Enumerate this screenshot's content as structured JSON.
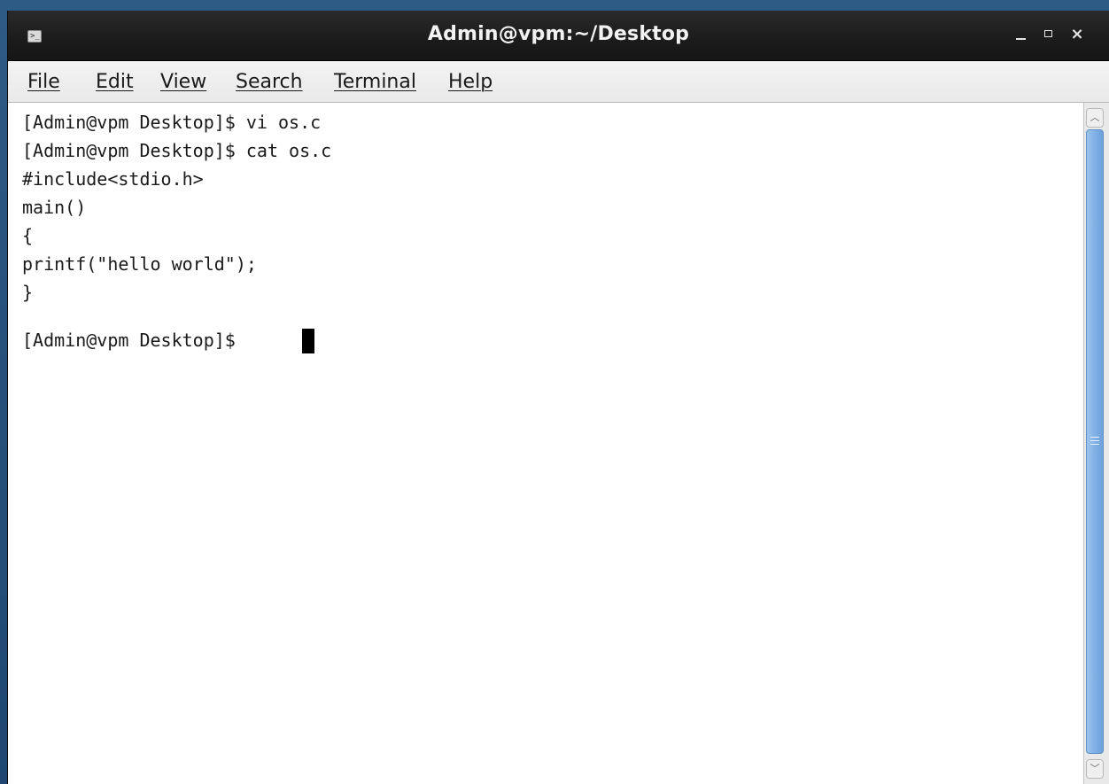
{
  "window": {
    "title": "Admin@vpm:~/Desktop",
    "icon": "terminal-icon",
    "controls": {
      "minimize": "minimize-icon",
      "maximize": "maximize-icon",
      "close_label": "×"
    }
  },
  "menubar": {
    "items": [
      {
        "label": "File"
      },
      {
        "label": "Edit"
      },
      {
        "label": "View"
      },
      {
        "label": "Search"
      },
      {
        "label": "Terminal"
      },
      {
        "label": "Help"
      }
    ]
  },
  "terminal": {
    "lines": [
      "[Admin@vpm Desktop]$ vi os.c",
      "[Admin@vpm Desktop]$ cat os.c",
      "#include<stdio.h>",
      "main()",
      "{",
      "printf(\"hello world\");",
      "}",
      "",
      "[Admin@vpm Desktop]$ "
    ]
  },
  "colors": {
    "titlebar": "#1b1b1b",
    "menubar": "#ededed",
    "terminal_bg": "#ffffff",
    "terminal_fg": "#1a1a1a",
    "scroll_thumb": "#7fb0e6"
  }
}
